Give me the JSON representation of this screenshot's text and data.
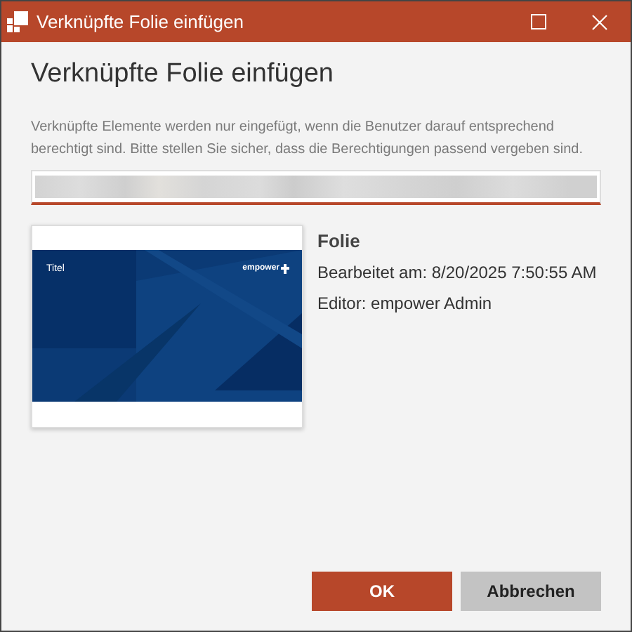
{
  "window": {
    "title": "Verknüpfte Folie einfügen"
  },
  "heading": "Verknüpfte Folie einfügen",
  "description": "Verknüpfte Elemente werden nur eingefügt, wenn die Benutzer darauf entsprechend berechtigt sind. Bitte stellen Sie sicher, dass die Berechtigungen passend vergeben sind.",
  "slide": {
    "title": "Titel",
    "logo": "empower"
  },
  "details": {
    "name": "Folie",
    "edited": "Bearbeitet am: 8/20/2025 7:50:55 AM",
    "editor": "Editor: empower Admin"
  },
  "buttons": [
    {
      "label": "OK",
      "kind": "primary"
    },
    {
      "label": "Abbrechen",
      "kind": "secondary"
    }
  ]
}
